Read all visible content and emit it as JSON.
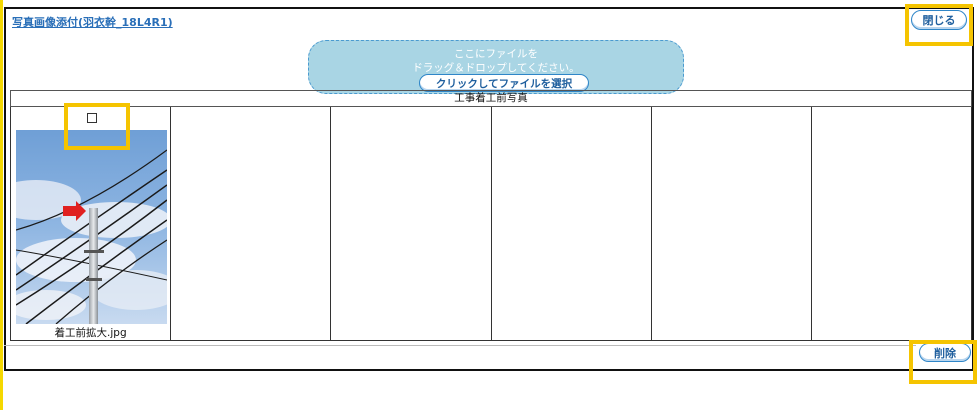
{
  "panel": {
    "title": "写真画像添付(羽衣幹_18L4R1)",
    "close_label": "閉じる",
    "delete_label": "削除"
  },
  "dropzone": {
    "line1": "ここにファイルを",
    "line2": "ドラッグ＆ドロップしてください。",
    "select_label": "クリックしてファイルを選択"
  },
  "grid": {
    "header": "工事着工前写真",
    "items": [
      {
        "filename": "着工前拡大.jpg",
        "checked": false
      }
    ]
  },
  "colors": {
    "accent_blue": "#2f86c8",
    "dropzone_bg": "#a9d5e4",
    "highlight": "#f5c400",
    "arrow_red": "#e02020"
  }
}
